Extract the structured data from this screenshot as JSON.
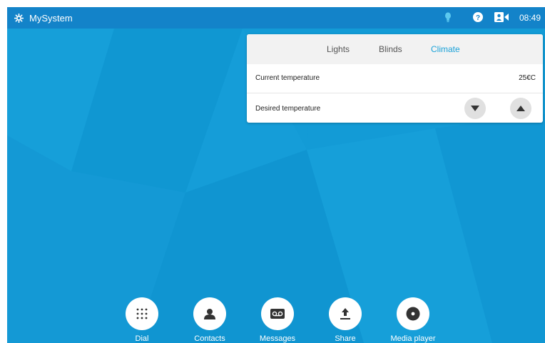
{
  "topbar": {
    "system_name": "MySystem",
    "time": "08:49",
    "icons": [
      "gear-icon",
      "lightbulb-icon",
      "help-icon",
      "camera-icon"
    ]
  },
  "panel": {
    "tabs": [
      {
        "label": "Lights",
        "active": false
      },
      {
        "label": "Blinds",
        "active": false
      },
      {
        "label": "Climate",
        "active": true
      }
    ],
    "current_temperature_label": "Current temperature",
    "current_temperature_value": "25€C",
    "desired_temperature_label": "Desired temperature",
    "controls": [
      "arrow-down-icon",
      "arrow-up-icon"
    ]
  },
  "dock": {
    "items": [
      {
        "label": "Dial",
        "icon": "dialpad-icon"
      },
      {
        "label": "Contacts",
        "icon": "contact-icon"
      },
      {
        "label": "Messages",
        "icon": "voicemail-icon"
      },
      {
        "label": "Share",
        "icon": "share-icon"
      },
      {
        "label": "Media player",
        "icon": "media-player-icon"
      }
    ]
  },
  "colors": {
    "background": "#139bd6",
    "topbar": "#1383c9",
    "accent": "#1aa1d8",
    "panel": "#ffffff"
  }
}
